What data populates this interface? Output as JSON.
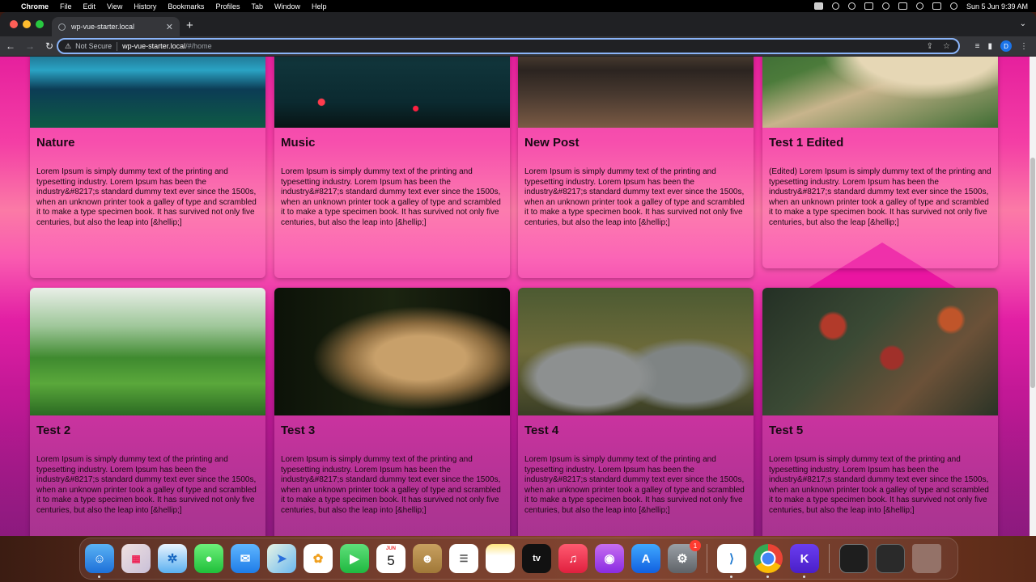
{
  "menubar": {
    "app_name": "Chrome",
    "menus": [
      "File",
      "Edit",
      "View",
      "History",
      "Bookmarks",
      "Profiles",
      "Tab",
      "Window",
      "Help"
    ],
    "datetime": "Sun 5 Jun  9:39 AM"
  },
  "browser": {
    "tab_title": "wp-vue-starter.local",
    "security_label": "Not Secure",
    "url_host": "wp-vue-starter.local",
    "url_path": "/#/home",
    "profile_initial": "D"
  },
  "cards": [
    {
      "title": "Nature",
      "text": "Lorem Ipsum is simply dummy text of the printing and typesetting industry. Lorem Ipsum has been the industry&#8217;s standard dummy text ever since the 1500s, when an unknown printer took a galley of type and scrambled it to make a type specimen book. It has survived not only five centuries, but also the leap into [&hellip;]"
    },
    {
      "title": "Music",
      "text": "Lorem Ipsum is simply dummy text of the printing and typesetting industry. Lorem Ipsum has been the industry&#8217;s standard dummy text ever since the 1500s, when an unknown printer took a galley of type and scrambled it to make a type specimen book. It has survived not only five centuries, but also the leap into [&hellip;]"
    },
    {
      "title": "New Post",
      "text": "Lorem Ipsum is simply dummy text of the printing and typesetting industry. Lorem Ipsum has been the industry&#8217;s standard dummy text ever since the 1500s, when an unknown printer took a galley of type and scrambled it to make a type specimen book. It has survived not only five centuries, but also the leap into [&hellip;]"
    },
    {
      "title": "Test 1 Edited",
      "text": "(Edited) Lorem Ipsum is simply dummy text of the printing and typesetting industry. Lorem Ipsum has been the industry&#8217;s standard dummy text ever since the 1500s, when an unknown printer took a galley of type and scrambled it to make a type specimen book. It has survived not only five centuries, but also the leap [&hellip;]"
    },
    {
      "title": "Test 2",
      "text": "Lorem Ipsum is simply dummy text of the printing and typesetting industry. Lorem Ipsum has been the industry&#8217;s standard dummy text ever since the 1500s, when an unknown printer took a galley of type and scrambled it to make a type specimen book. It has survived not only five centuries, but also the leap into [&hellip;]"
    },
    {
      "title": "Test 3",
      "text": "Lorem Ipsum is simply dummy text of the printing and typesetting industry. Lorem Ipsum has been the industry&#8217;s standard dummy text ever since the 1500s, when an unknown printer took a galley of type and scrambled it to make a type specimen book. It has survived not only five centuries, but also the leap into [&hellip;]"
    },
    {
      "title": "Test 4",
      "text": "Lorem Ipsum is simply dummy text of the printing and typesetting industry. Lorem Ipsum has been the industry&#8217;s standard dummy text ever since the 1500s, when an unknown printer took a galley of type and scrambled it to make a type specimen book. It has survived not only five centuries, but also the leap into [&hellip;]"
    },
    {
      "title": "Test 5",
      "text": "Lorem Ipsum is simply dummy text of the printing and typesetting industry. Lorem Ipsum has been the industry&#8217;s standard dummy text ever since the 1500s, when an unknown printer took a galley of type and scrambled it to make a type specimen book. It has survived not only five centuries, but also the leap into [&hellip;]"
    }
  ],
  "dock": {
    "calendar_month": "JUN",
    "calendar_day": "5",
    "settings_badge": "1",
    "apple_tv_label": "tv",
    "kinsta_label": "K"
  }
}
